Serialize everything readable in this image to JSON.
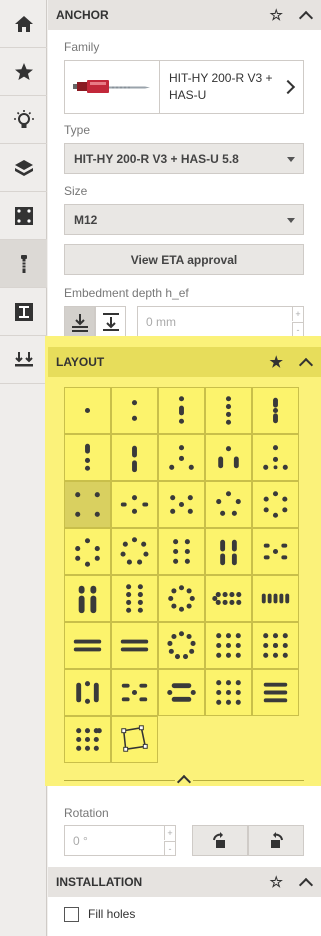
{
  "nav": {
    "items": [
      {
        "icon": "home-icon"
      },
      {
        "icon": "star-icon"
      },
      {
        "icon": "lightbulb-icon"
      },
      {
        "icon": "base-material-icon"
      },
      {
        "icon": "baseplate-icon"
      },
      {
        "icon": "anchor-icon",
        "active": true
      },
      {
        "icon": "profile-icon"
      },
      {
        "icon": "loads-icon"
      }
    ]
  },
  "anchor": {
    "title": "ANCHOR",
    "family_label": "Family",
    "family_name": "HIT-HY 200-R V3 + HAS-U",
    "type_label": "Type",
    "type_value": "HIT-HY 200-R V3 + HAS-U 5.8",
    "size_label": "Size",
    "size_value": "M12",
    "eta_button": "View ETA approval",
    "embedment_label": "Embedment depth h_ef",
    "embedment_placeholder": "0 mm",
    "spin_up": "+",
    "spin_down": "-"
  },
  "layout": {
    "title": "LAYOUT",
    "selected_index": 10,
    "patterns": [
      "1",
      "2",
      "3",
      "4",
      "5",
      "3-tri",
      "4-line",
      "3-tri-b",
      "4-tri",
      "5-tri",
      "2x2",
      "2x3",
      "3x2-ring",
      "5-ring",
      "6-ring",
      "6-ring-b",
      "7-ring",
      "3x2",
      "4x2",
      "3x3",
      "4x2-b",
      "3x3-b",
      "8-ring",
      "5x2",
      "5x2-b",
      "5x2-c",
      "5x2-d",
      "9-ring",
      "4x3",
      "4x3-b",
      "5x3",
      "4x4",
      "4x4-b",
      "4x3-c",
      "5x3-b",
      "4x3-d",
      "custom"
    ]
  },
  "rotation": {
    "label": "Rotation",
    "placeholder": "0 °",
    "spin_up": "+",
    "spin_down": "-"
  },
  "installation": {
    "title": "INSTALLATION",
    "fill_holes_label": "Fill holes"
  },
  "colors": {
    "highlight": "#fbf27a",
    "header": "#e6e3e0"
  }
}
